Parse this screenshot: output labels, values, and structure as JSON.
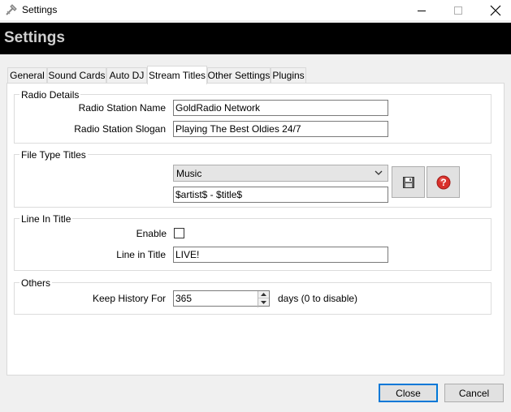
{
  "window": {
    "title": "Settings",
    "icon": "settings-app-icon",
    "controls": [
      "minimize-icon",
      "maximize-icon",
      "close-icon"
    ]
  },
  "banner": {
    "title": "Settings"
  },
  "tabs": [
    {
      "label": "General",
      "active": false
    },
    {
      "label": "Sound Cards",
      "active": false
    },
    {
      "label": "Auto DJ",
      "active": false
    },
    {
      "label": "Stream Titles",
      "active": true
    },
    {
      "label": "Other Settings",
      "active": false
    },
    {
      "label": "Plugins",
      "active": false
    }
  ],
  "radio_details": {
    "group_label": "Radio Details",
    "station_name_label": "Radio Station Name",
    "station_name_value": "GoldRadio Network",
    "station_slogan_label": "Radio Station Slogan",
    "station_slogan_value": "Playing The Best Oldies 24/7"
  },
  "file_type_titles": {
    "group_label": "File Type Titles",
    "selected_type": "Music",
    "format_value": "$artist$ - $title$",
    "save_icon": "save-icon",
    "help_icon": "help-icon"
  },
  "line_in_title": {
    "group_label": "Line In Title",
    "enable_label": "Enable",
    "enable_checked": false,
    "title_label": "Line in Title",
    "title_value": "LIVE!"
  },
  "others": {
    "group_label": "Others",
    "keep_history_label": "Keep History For",
    "keep_history_value": "365",
    "days_label": "days (0 to disable)"
  },
  "footer": {
    "close_label": "Close",
    "cancel_label": "Cancel"
  },
  "colors": {
    "banner_bg": "#000000",
    "banner_text": "#cfcfcf",
    "default_button_border": "#0078d7",
    "help_icon_red": "#d9302b"
  }
}
